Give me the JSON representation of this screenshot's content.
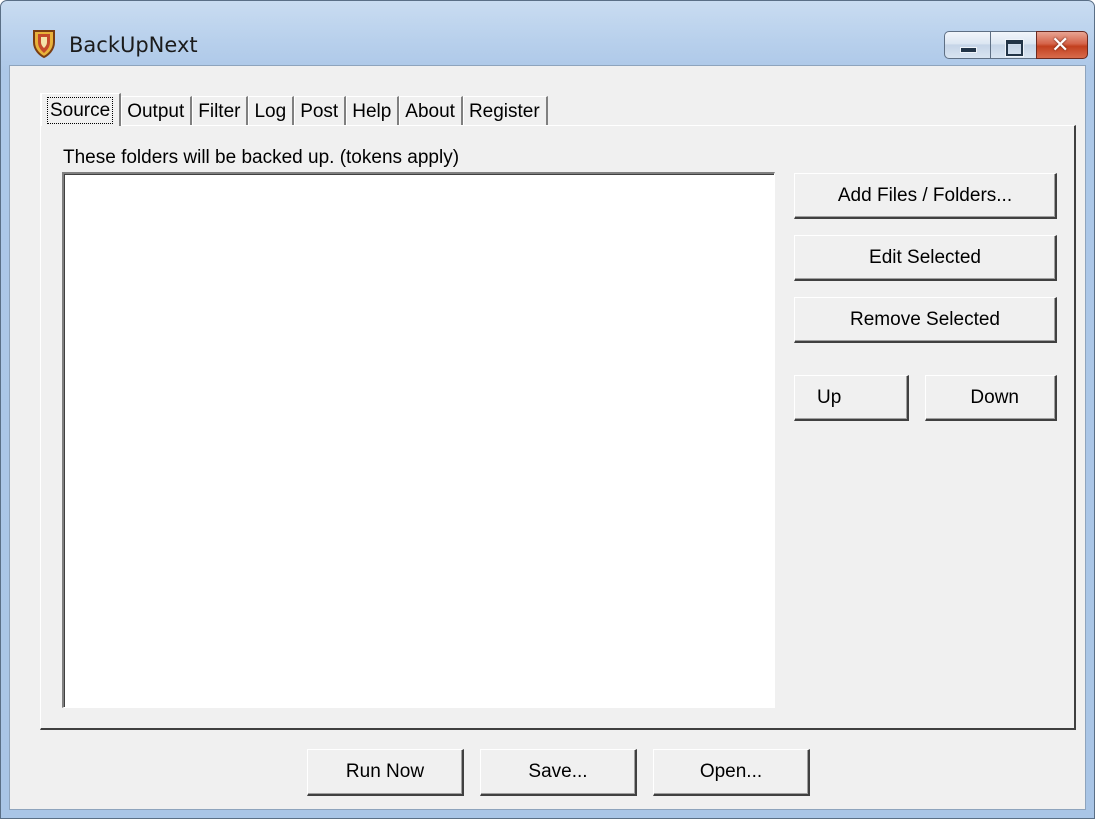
{
  "window": {
    "title": "BackUpNext"
  },
  "tabs": [
    {
      "label": "Source",
      "active": true
    },
    {
      "label": "Output"
    },
    {
      "label": "Filter"
    },
    {
      "label": "Log"
    },
    {
      "label": "Post"
    },
    {
      "label": "Help"
    },
    {
      "label": "About"
    },
    {
      "label": "Register"
    }
  ],
  "source": {
    "caption": "These folders will be backed up. (tokens apply)",
    "buttons": {
      "add": "Add Files / Folders...",
      "edit": "Edit Selected",
      "remove": "Remove Selected",
      "up": "Up",
      "down": "Down"
    }
  },
  "footer": {
    "run_now": "Run Now",
    "save": "Save...",
    "open": "Open..."
  },
  "icons": {
    "app": "shield-icon",
    "minimize": "minimize-icon",
    "maximize": "maximize-icon",
    "close": "close-icon"
  }
}
